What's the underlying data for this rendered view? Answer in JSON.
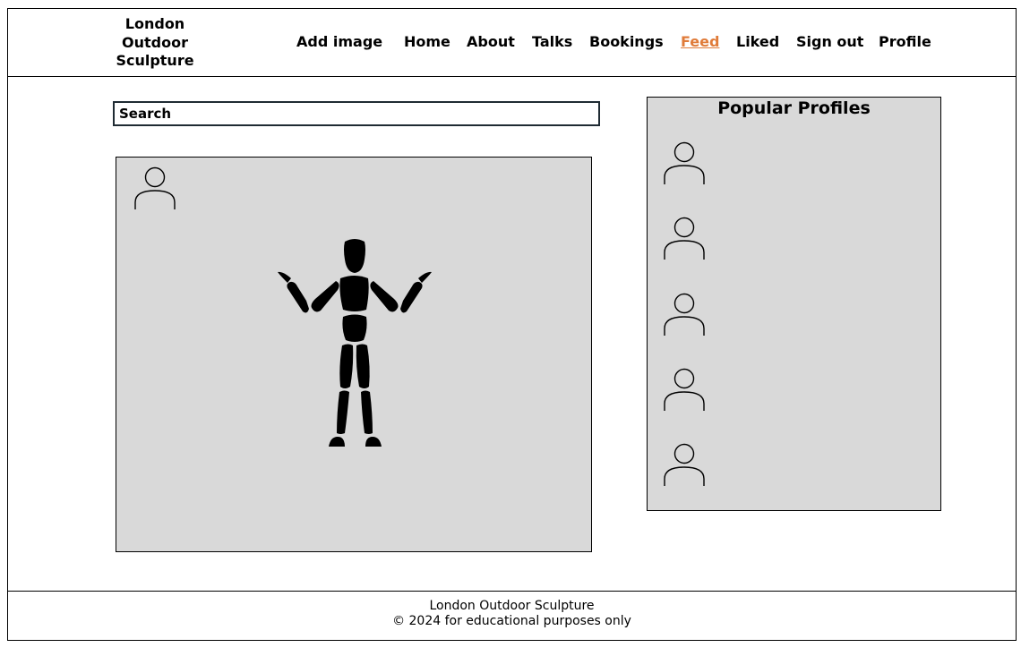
{
  "brand": {
    "line1": "London",
    "line2": "Outdoor",
    "line3": "Sculpture"
  },
  "nav": {
    "items": [
      {
        "label": "Add image",
        "active": false
      },
      {
        "label": "Home",
        "active": false
      },
      {
        "label": "About",
        "active": false
      },
      {
        "label": "Talks",
        "active": false
      },
      {
        "label": "Bookings",
        "active": false
      },
      {
        "label": "Feed",
        "active": true
      },
      {
        "label": "Liked",
        "active": false
      },
      {
        "label": "Sign out",
        "active": false
      },
      {
        "label": "Profile",
        "active": false
      }
    ]
  },
  "search": {
    "placeholder": "Search"
  },
  "feed": {
    "post_author_icon": "user-icon",
    "post_image_icon": "wooden-mannequin-icon"
  },
  "popular": {
    "title": "Popular Profiles",
    "profile_icons": [
      "user-icon",
      "user-icon",
      "user-icon",
      "user-icon",
      "user-icon"
    ]
  },
  "footer": {
    "line1": "London Outdoor Sculpture",
    "line2": "© 2024 for educational purposes only"
  },
  "colors": {
    "accent": "#e07b39",
    "panel": "#d9d9d9",
    "border": "#000000"
  }
}
